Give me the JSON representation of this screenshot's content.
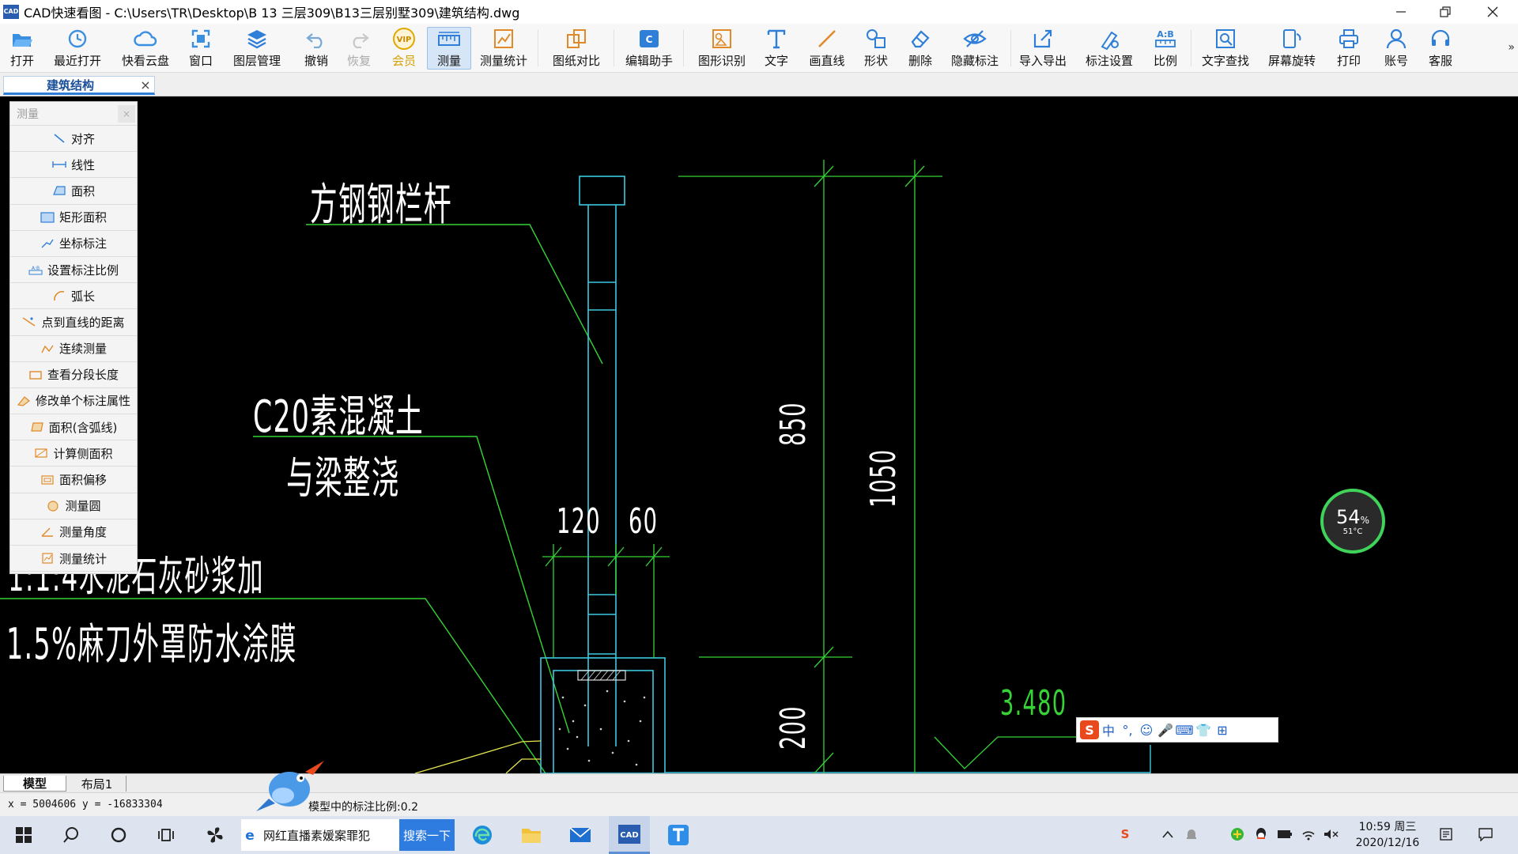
{
  "window": {
    "app_icon_text": "CAD",
    "title": "CAD快速看图 - C:\\Users\\TR\\Desktop\\B 13 三层309\\B13三层别墅309\\建筑结构.dwg"
  },
  "toolbar": {
    "items": [
      {
        "label": "打开",
        "icon": "folder-open-icon"
      },
      {
        "label": "最近打开",
        "icon": "history-icon"
      },
      {
        "label": "快看云盘",
        "icon": "cloud-icon"
      },
      {
        "label": "窗口",
        "icon": "window-fit-icon"
      },
      {
        "label": "图层管理",
        "icon": "layers-icon"
      },
      {
        "label": "撤销",
        "icon": "undo-icon"
      },
      {
        "label": "恢复",
        "icon": "redo-icon"
      },
      {
        "label": "会员",
        "icon": "vip-icon"
      },
      {
        "label": "测量",
        "icon": "ruler-icon"
      },
      {
        "label": "测量统计",
        "icon": "measure-stats-icon"
      },
      {
        "label": "图纸对比",
        "icon": "compare-icon"
      },
      {
        "label": "编辑助手",
        "icon": "edit-helper-icon"
      },
      {
        "label": "图形识别",
        "icon": "shape-recognize-icon"
      },
      {
        "label": "文字",
        "icon": "text-icon"
      },
      {
        "label": "画直线",
        "icon": "line-icon"
      },
      {
        "label": "形状",
        "icon": "shapes-icon"
      },
      {
        "label": "删除",
        "icon": "eraser-icon"
      },
      {
        "label": "隐藏标注",
        "icon": "eye-slash-icon"
      },
      {
        "label": "导入导出",
        "icon": "import-export-icon"
      },
      {
        "label": "标注设置",
        "icon": "annotation-settings-icon"
      },
      {
        "label": "比例",
        "icon": "scale-icon"
      },
      {
        "label": "文字查找",
        "icon": "text-search-icon"
      },
      {
        "label": "屏幕旋转",
        "icon": "rotate-screen-icon"
      },
      {
        "label": "打印",
        "icon": "printer-icon"
      },
      {
        "label": "账号",
        "icon": "user-icon"
      },
      {
        "label": "客服",
        "icon": "headset-icon"
      }
    ],
    "more": "»",
    "vip_badge": "VIP"
  },
  "tab": {
    "label": "建筑结构",
    "close": "×"
  },
  "measure_panel": {
    "title": "测量",
    "close": "×",
    "items": [
      "对齐",
      "线性",
      "面积",
      "矩形面积",
      "坐标标注",
      "设置标注比例",
      "弧长",
      "点到直线的距离",
      "连续测量",
      "查看分段长度",
      "修改单个标注属性",
      "面积(含弧线)",
      "计算侧面积",
      "面积偏移",
      "测量圆",
      "测量角度",
      "测量统计"
    ]
  },
  "drawing": {
    "labels": {
      "railing": "方钢钢栏杆",
      "concrete": "C20素混凝土",
      "pour": "与梁整浇",
      "mortar": "1:1:4水泥石灰砂浆加",
      "waterproof": "1.5%麻刀外罩防水涂膜",
      "dim_120": "120",
      "dim_60": "60",
      "dim_850": "850",
      "dim_1050": "1050",
      "dim_200": "200",
      "elevation": "3.480"
    },
    "colors": {
      "cyan": "#3cc8e0",
      "green": "#35d335",
      "yellow": "#e8e850",
      "white": "#ffffff"
    }
  },
  "temp_widget": {
    "percent": "54",
    "percent_sign": "%",
    "temp": "51°C"
  },
  "ime": {
    "logo": "S",
    "items": [
      "中",
      "°,",
      "☺",
      "🎤",
      "⌨",
      "👕",
      "⊞"
    ]
  },
  "layout_tabs": {
    "model": "模型",
    "layout1": "布局1"
  },
  "status": {
    "coords": "x = 5004606  y = -16833304",
    "scale": "模型中的标注比例:0.2"
  },
  "taskbar": {
    "search_text": "网红直播素媛案罪犯",
    "search_button": "搜索一下",
    "time": "10:59 周三",
    "date": "2020/12/16",
    "cad_label": "CAD"
  }
}
